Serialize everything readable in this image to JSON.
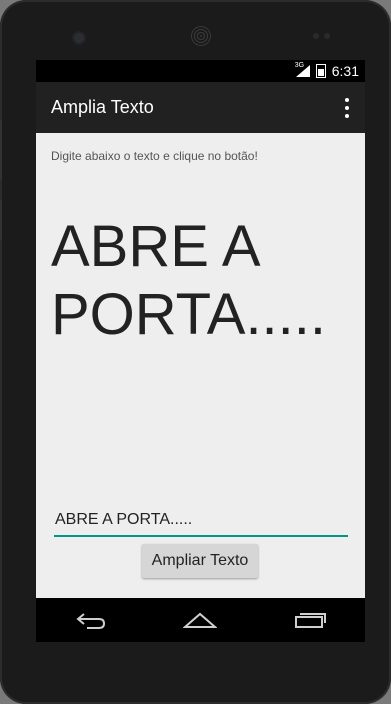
{
  "status_bar": {
    "network": "3G",
    "time": "6:31"
  },
  "action_bar": {
    "title": "Amplia Texto",
    "overflow_icon": "more-vert-icon"
  },
  "content": {
    "instruction": "Digite abaixo o texto e clique no botão!",
    "enlarged_text": "ABRE A PORTA.....",
    "input_value": "ABRE A PORTA.....",
    "button_label": "Ampliar Texto",
    "accent_color": "#009688"
  },
  "nav_bar": {
    "icons": [
      "back-icon",
      "home-icon",
      "recent-apps-icon"
    ]
  }
}
